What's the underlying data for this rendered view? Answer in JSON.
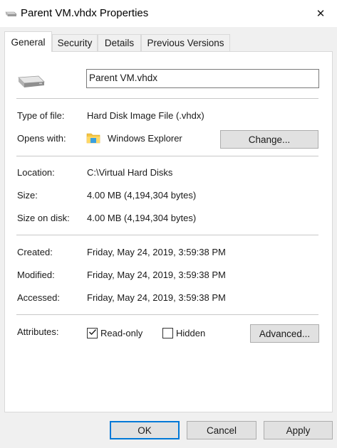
{
  "window": {
    "title": "Parent VM.vhdx Properties",
    "title_icon": "drive-icon",
    "close_glyph": "✕"
  },
  "tabs": [
    {
      "label": "General",
      "active": true
    },
    {
      "label": "Security",
      "active": false
    },
    {
      "label": "Details",
      "active": false
    },
    {
      "label": "Previous Versions",
      "active": false
    }
  ],
  "general": {
    "filename": "Parent VM.vhdx",
    "type_label": "Type of file:",
    "type_value": "Hard Disk Image File (.vhdx)",
    "opens_label": "Opens with:",
    "opens_value": "Windows Explorer",
    "change_button": "Change...",
    "location_label": "Location:",
    "location_value": "C:\\Virtual Hard Disks",
    "size_label": "Size:",
    "size_value": "4.00 MB (4,194,304 bytes)",
    "size_on_disk_label": "Size on disk:",
    "size_on_disk_value": "4.00 MB (4,194,304 bytes)",
    "created_label": "Created:",
    "created_value": "Friday, May 24, 2019, 3:59:38 PM",
    "modified_label": "Modified:",
    "modified_value": "Friday, May 24, 2019, 3:59:38 PM",
    "accessed_label": "Accessed:",
    "accessed_value": "Friday, May 24, 2019, 3:59:38 PM",
    "attributes_label": "Attributes:",
    "readonly_label": "Read-only",
    "readonly_checked": true,
    "hidden_label": "Hidden",
    "hidden_checked": false,
    "advanced_button": "Advanced..."
  },
  "footer": {
    "ok": "OK",
    "cancel": "Cancel",
    "apply": "Apply"
  },
  "colors": {
    "accent": "#0078d7",
    "panel_bg": "#ffffff",
    "window_bg": "#f0f0f0"
  }
}
